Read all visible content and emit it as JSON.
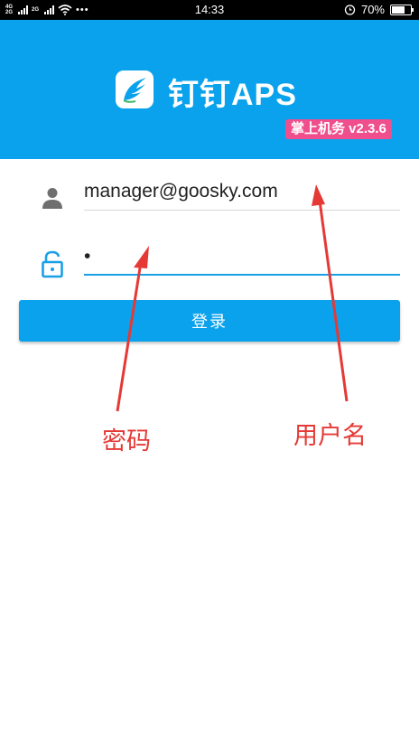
{
  "status_bar": {
    "network_1": "4G 2G",
    "network_2": "2G",
    "dots": "•••",
    "time": "14:33",
    "battery": "70%"
  },
  "header": {
    "app_title": "钉钉APS",
    "version_badge": "掌上机务 v2.3.6",
    "background_color": "#0aa2ec",
    "badge_color": "#ef4f8c"
  },
  "form": {
    "username_value": "manager@goosky.com",
    "password_value": "•",
    "login_button_label": "登录",
    "accent_color": "#1aa0e6"
  },
  "annotations": {
    "password_label": "密码",
    "username_label": "用户名",
    "annotation_color": "#e53935"
  },
  "icons": [
    "user-icon",
    "lock-icon",
    "app-logo-icon",
    "wifi-icon",
    "alarm-icon",
    "battery-icon"
  ]
}
